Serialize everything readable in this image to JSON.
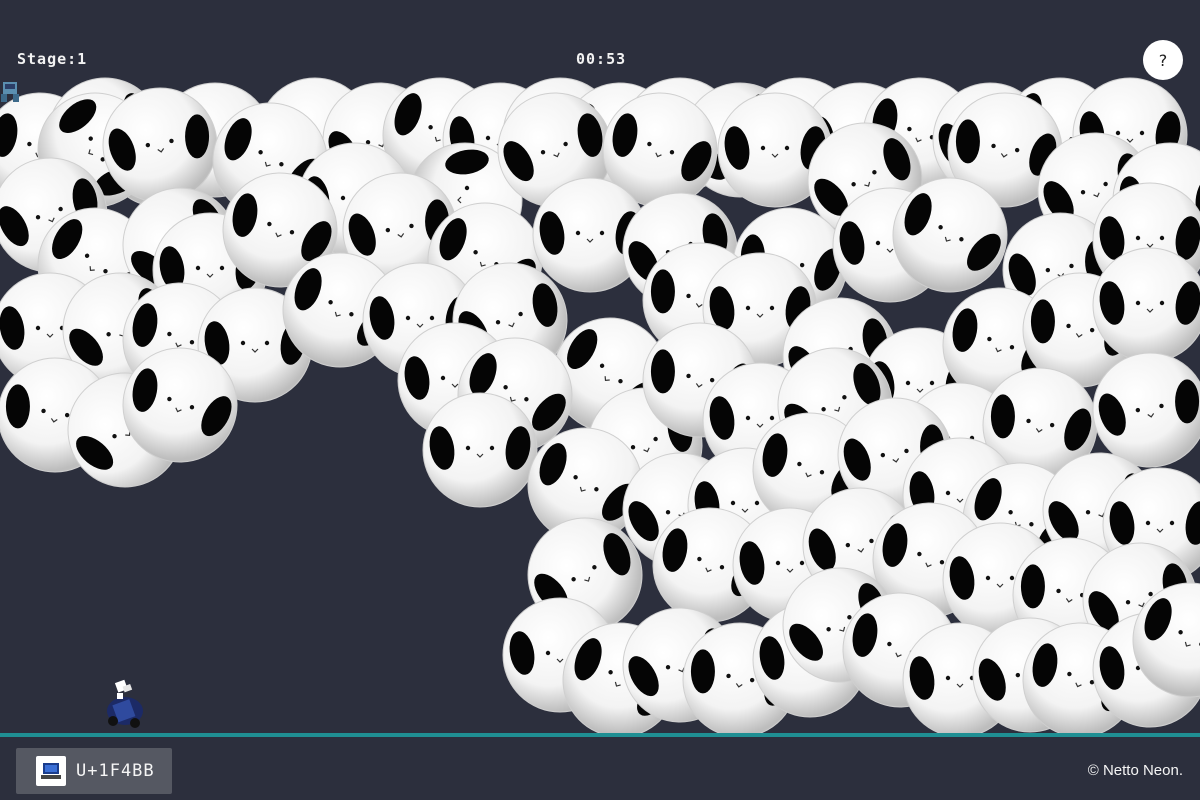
{
  "hud": {
    "stage_label": "Stage:1",
    "timer": "00:53",
    "help_label": "?"
  },
  "footer": {
    "emoji_code": "U+1F4BB",
    "emoji_icon": "laptop-icon",
    "copyright": "© Netto Neon."
  },
  "colors": {
    "background": "#2c2f3d",
    "ground": "#1f8f93",
    "ball": "#ffffff",
    "patch": "#000000"
  },
  "game": {
    "ball_character": "panda-face",
    "player_character": "robot-car",
    "life_icon": "robot-icon"
  }
}
